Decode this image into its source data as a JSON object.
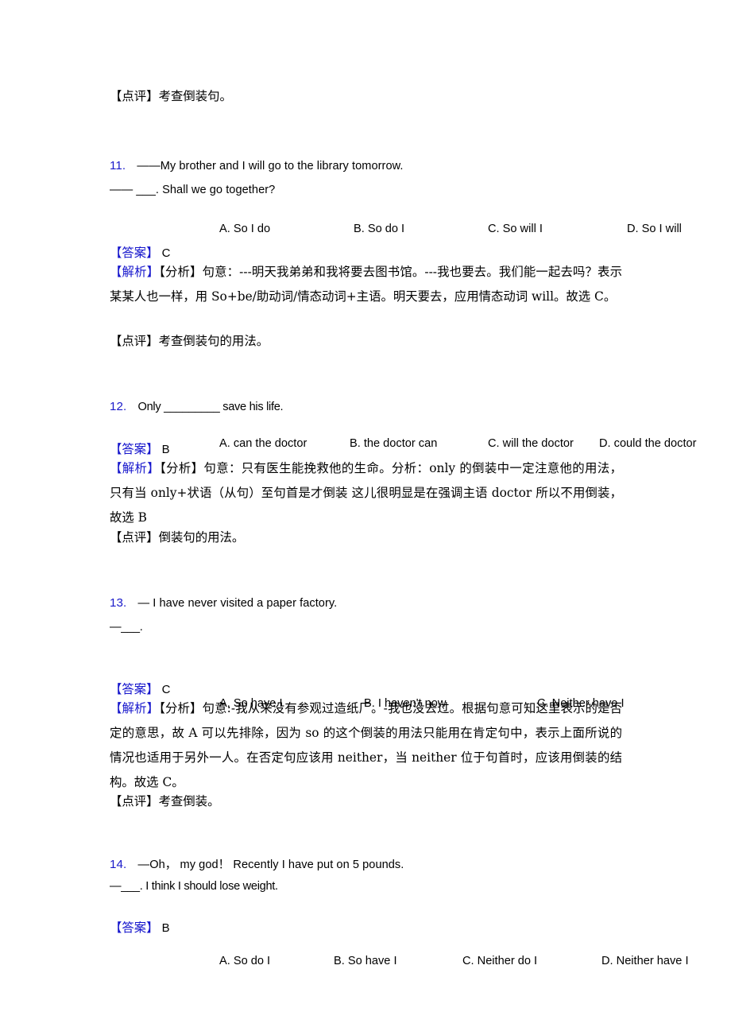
{
  "document": {
    "top_note": "【点评】考查倒装句。",
    "labels": {
      "answer_tag": "【答案】",
      "analysis_tag": "【解析】",
      "analysis_sub_tag": "【分析】",
      "comment_tag": "【点评】"
    },
    "colors": {
      "marker_blue": "#1414cc",
      "number_blue": "#1a1aca",
      "text_black": "#000000",
      "page_background": "#ffffff"
    }
  },
  "questions": [
    {
      "number": "11.",
      "stem_line1": "——My brother and I will go to the library tomorrow.",
      "stem_line2": "—— ___. Shall we go together?",
      "options": [
        "A. So I do",
        "B. So do I",
        "C. So will I",
        "D. So I will"
      ],
      "answer": "C",
      "analysis_lines": [
        "句意：---明天我弟弟和我将要去图书馆。---我也要去。我们能一起去吗？表示某某人也一样，用 So+be/助动词/情态动词+主语。明天要去，应用情态动词 will。故选 C。"
      ],
      "comment": "考查倒装句的用法。"
    },
    {
      "number": "12.",
      "stem_line1": "Only _________ save his life.",
      "options": [
        "A. can the doctor",
        "B. the doctor can",
        "C. will the doctor",
        "D. could the doctor"
      ],
      "answer": "B",
      "analysis_lines": [
        "句意：只有医生能挽救他的生命。分析：only 的倒装中一定注意他的用法，只有当 only+状语（从句）至句首是才倒装 这儿很明显是在强调主语 doctor 所以不用倒装，故选 B"
      ],
      "comment": "倒装句的用法。"
    },
    {
      "number": "13.",
      "stem_line1": "— I have never visited a paper factory.",
      "stem_line2": "—___.",
      "options": [
        "A. So have I",
        "B. I haven't now",
        "C. Neither have I"
      ],
      "answer": "C",
      "analysis_lines": [
        "句意:-我从来没有参观过造纸厂。-我也没去过。根据句意可知这里表示的是否定的意思，故 A 可以先排除，因为 so 的这个倒装的用法只能用在肯定句中，表示上面所说的情况也适用于另外一人。在否定句应该用 neither，当 neither 位于句首时，应该用倒装的结构。故选 C。"
      ],
      "comment": "考查倒装。"
    },
    {
      "number": "14.",
      "stem_line1": "—Oh，  my god！  Recently I have put on 5 pounds.",
      "stem_line2": "—___. I think I should lose weight.",
      "options": [
        "A. So do I",
        "B. So have I",
        "C. Neither do I",
        "D. Neither have I"
      ],
      "answer": "B"
    }
  ]
}
